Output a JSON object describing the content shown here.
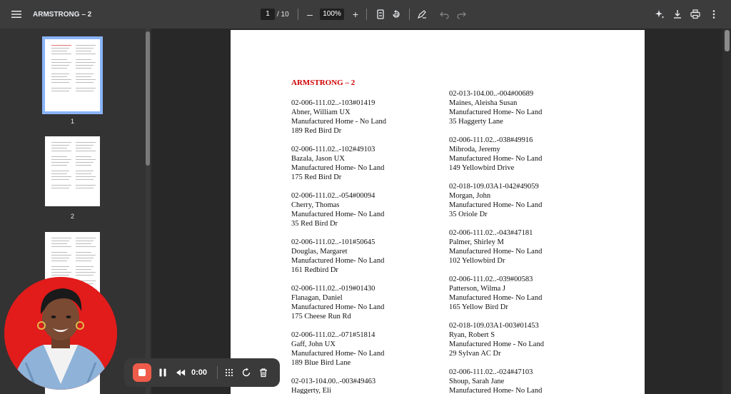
{
  "toolbar": {
    "title": "ARMSTRONG – 2",
    "current_page": "1",
    "total_pages": "/ 10",
    "zoom": "100%",
    "zoom_out": "–",
    "zoom_in": "+"
  },
  "sidebar": {
    "thumbnails": [
      {
        "label": "1",
        "selected": true
      },
      {
        "label": "2",
        "selected": false
      },
      {
        "label": "",
        "selected": false
      }
    ]
  },
  "document": {
    "heading": "ARMSTRONG – 2",
    "left_column": [
      {
        "parcel": "02-006-111.02..-103#01419",
        "owner": "Abner, William UX",
        "type": "Manufactured Home - No Land",
        "address": "189 Red Bird Dr"
      },
      {
        "parcel": "02-006-111.02..-102#49103",
        "owner": "Bazala, Jason UX",
        "type": "Manufactured Home- No Land",
        "address": "175 Red Bird Dr"
      },
      {
        "parcel": "02-006-111.02..-054#00094",
        "owner": "Cherry, Thomas",
        "type": "Manufactured Home- No Land",
        "address": "35 Red Bird Dr"
      },
      {
        "parcel": "02-006-111.02..-101#50645",
        "owner": "Douglas, Margaret",
        "type": "Manufactured Home- No Land",
        "address": "161 Redbird Dr"
      },
      {
        "parcel": "02-006-111.02..-019#01430",
        "owner": "Flanagan, Daniel",
        "type": "Manufactured Home- No Land",
        "address": "175 Cheese Run Rd"
      },
      {
        "parcel": "02-006-111.02..-071#51814",
        "owner": "Gaff, John UX",
        "type": "Manufactured Home- No Land",
        "address": "189 Blue Bird Lane"
      },
      {
        "parcel": "02-013-104.00..-003#49463",
        "owner": "Haggerty, Eli",
        "type": "",
        "address": ""
      }
    ],
    "right_column": [
      {
        "parcel": "02-013-104.00..-004#00689",
        "owner": "Maines, Aleisha Susan",
        "type": "Manufactured Home- No Land",
        "address": "35 Haggerty Lane"
      },
      {
        "parcel": "02-006-111.02..-038#49916",
        "owner": "Mibroda, Jeremy",
        "type": "Manufactured Home- No Land",
        "address": "149 Yellowbird Drive"
      },
      {
        "parcel": "02-018-109.03A1-042#49059",
        "owner": "Morgan, John",
        "type": "Manufactured Home- No Land",
        "address": "35 Oriole Dr"
      },
      {
        "parcel": "02-006-111.02..-043#47181",
        "owner": "Palmer, Shirley M",
        "type": "Manufactured Home- No Land",
        "address": "102 Yellowbird Dr"
      },
      {
        "parcel": "02-006-111.02..-039#00583",
        "owner": "Patterson, Wilma J",
        "type": "Manufactured Home- No Land",
        "address": "165 Yellow Bird Dr"
      },
      {
        "parcel": "02-018-109.03A1-003#01453",
        "owner": "Ryan, Robert S",
        "type": "Manufactured Home - No Land",
        "address": "29 Sylvan AC Dr"
      },
      {
        "parcel": "02-006-111.02..-024#47103",
        "owner": "Shoup, Sarah Jane",
        "type": "Manufactured Home- No Land",
        "address": ""
      }
    ]
  },
  "recorder": {
    "time": "0:00"
  },
  "colors": {
    "heading_red": "#d00000",
    "record_stop": "#ef5b4b",
    "thumb_selected": "#8ab4f8",
    "cam_background": "#e21b1b"
  }
}
